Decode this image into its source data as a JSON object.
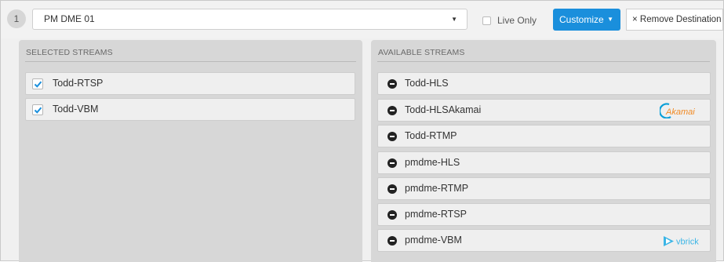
{
  "header": {
    "destination_number": "1",
    "destination_select": "PM DME 01",
    "live_only_label": "Live Only",
    "customize_label": "Customize",
    "remove_label": "× Remove Destination"
  },
  "selected": {
    "title": "SELECTED STREAMS",
    "items": [
      {
        "label": "Todd-RTSP",
        "checked": true
      },
      {
        "label": "Todd-VBM",
        "checked": true
      }
    ]
  },
  "available": {
    "title": "AVAILABLE STREAMS",
    "items": [
      {
        "label": "Todd-HLS",
        "logo": ""
      },
      {
        "label": "Todd-HLSAkamai",
        "logo": "akamai-logo"
      },
      {
        "label": "Todd-RTMP",
        "logo": ""
      },
      {
        "label": "pmdme-HLS",
        "logo": ""
      },
      {
        "label": "pmdme-RTMP",
        "logo": ""
      },
      {
        "label": "pmdme-RTSP",
        "logo": ""
      },
      {
        "label": "pmdme-VBM",
        "logo": "vbrick-logo"
      }
    ]
  },
  "logos": {
    "akamai_text": "Akamai",
    "vbrick_text": "vbrick"
  },
  "colors": {
    "accent": "#1a8fdc",
    "panel_bg": "#d7d7d7",
    "item_bg": "#efefef",
    "akamai_orange": "#f08a24",
    "akamai_blue": "#0a9fd8",
    "vbrick_blue": "#3ab5e6"
  }
}
